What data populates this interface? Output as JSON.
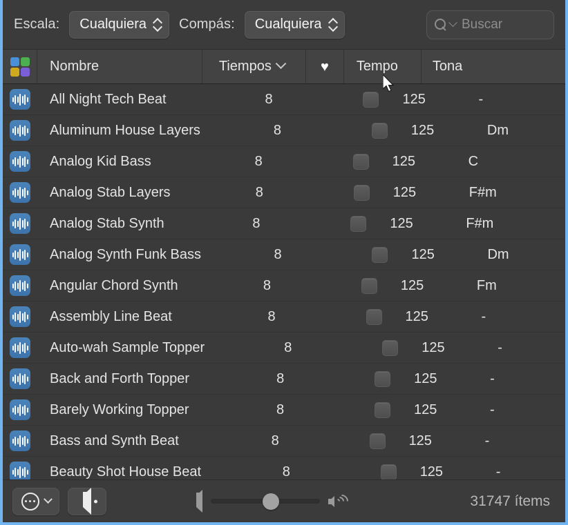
{
  "filter_bar": {
    "scale_label": "Escala:",
    "scale_value": "Cualquiera",
    "meter_label": "Compás:",
    "meter_value": "Cualquiera",
    "search_placeholder": "Buscar"
  },
  "columns": {
    "grid_icon": "grid-view-icon",
    "name": "Nombre",
    "beats": "Tiempos",
    "favorite": "favorite-heart-icon",
    "tempo": "Tempo",
    "key": "Tona"
  },
  "grid_icon_colors": {
    "top_left": "#4a90d9",
    "top_right": "#4caf50",
    "bottom_left": "#cfa91e",
    "bottom_right": "#7b5fd6"
  },
  "accents": {
    "window_border": "#72b4f0",
    "loop_icon": "#4479ae",
    "header_bg": "#434343",
    "list_bg": "#3a3a3a",
    "text": "#e4e4e4"
  },
  "rows": [
    {
      "icon": "audio-loop-icon",
      "name": "All Night Tech Beat",
      "beats": "8",
      "tempo": "125",
      "key": "-"
    },
    {
      "icon": "audio-loop-icon",
      "name": "Aluminum House Layers",
      "beats": "8",
      "tempo": "125",
      "key": "Dm"
    },
    {
      "icon": "audio-loop-icon",
      "name": "Analog Kid Bass",
      "beats": "8",
      "tempo": "125",
      "key": "C"
    },
    {
      "icon": "audio-loop-icon",
      "name": "Analog Stab Layers",
      "beats": "8",
      "tempo": "125",
      "key": "F#m"
    },
    {
      "icon": "audio-loop-icon",
      "name": "Analog Stab Synth",
      "beats": "8",
      "tempo": "125",
      "key": "F#m"
    },
    {
      "icon": "audio-loop-icon",
      "name": "Analog Synth Funk Bass",
      "beats": "8",
      "tempo": "125",
      "key": "Dm"
    },
    {
      "icon": "audio-loop-icon",
      "name": "Angular Chord Synth",
      "beats": "8",
      "tempo": "125",
      "key": "Fm"
    },
    {
      "icon": "audio-loop-icon",
      "name": "Assembly Line Beat",
      "beats": "8",
      "tempo": "125",
      "key": "-"
    },
    {
      "icon": "audio-loop-icon",
      "name": "Auto-wah Sample Topper",
      "beats": "8",
      "tempo": "125",
      "key": "-"
    },
    {
      "icon": "audio-loop-icon",
      "name": "Back and Forth Topper",
      "beats": "8",
      "tempo": "125",
      "key": "-"
    },
    {
      "icon": "audio-loop-icon",
      "name": "Barely Working Topper",
      "beats": "8",
      "tempo": "125",
      "key": "-"
    },
    {
      "icon": "audio-loop-icon",
      "name": "Bass and Synth Beat",
      "beats": "8",
      "tempo": "125",
      "key": "-"
    },
    {
      "icon": "audio-loop-icon",
      "name": "Beauty Shot House Beat",
      "beats": "8",
      "tempo": "125",
      "key": "-"
    }
  ],
  "bottom_bar": {
    "action_menu_icon": "circle-ellipsis-icon",
    "action_menu_chevron": "chevron-down-icon",
    "mute_icon": "speaker-icon",
    "volume_low_icon": "speaker-low-icon",
    "volume_high_icon": "speaker-high-icon",
    "volume_percent": 55,
    "items_count": "31747 ítems"
  }
}
